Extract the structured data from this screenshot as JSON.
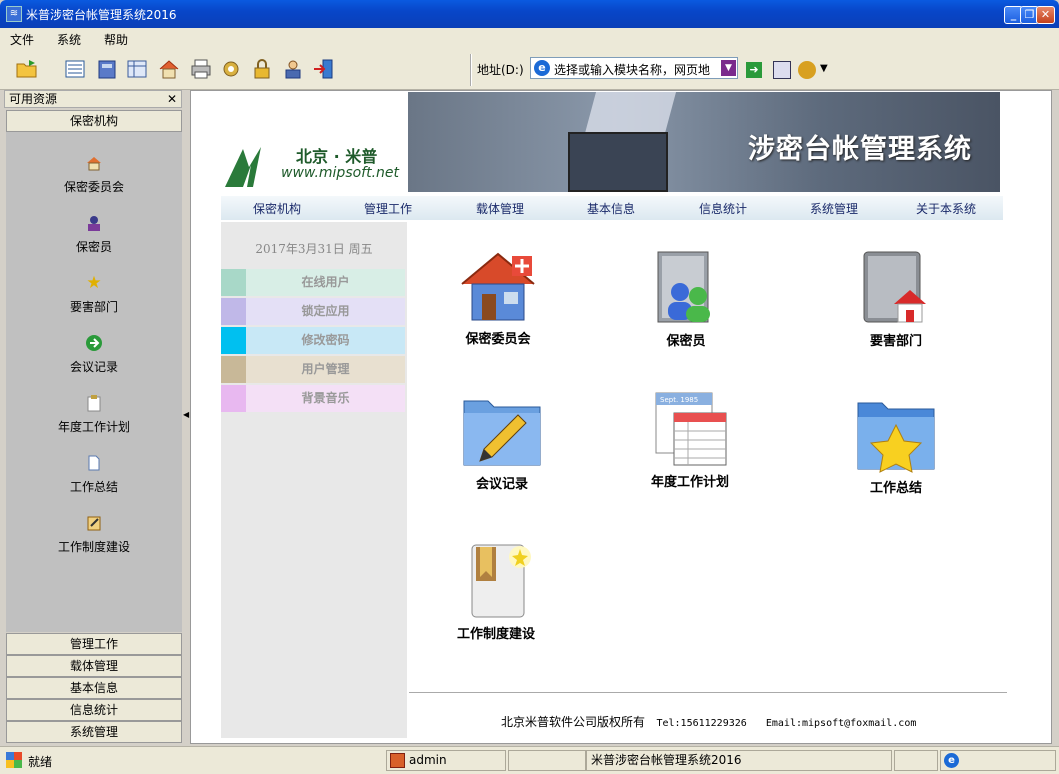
{
  "window": {
    "title": "米普涉密台帐管理系统2016",
    "min_icon": "minimize-icon",
    "max_icon": "restore-icon",
    "close_icon": "close-icon"
  },
  "menu": [
    "文件",
    "系统",
    "帮助"
  ],
  "toolbar": {
    "icons": [
      "open-icon",
      "list-icon",
      "book-icon",
      "table-icon",
      "home-icon",
      "print-icon",
      "settings-icon",
      "lock-icon",
      "user-lock-icon",
      "exit-icon"
    ]
  },
  "address": {
    "label": "地址(D:)",
    "value": "选择或输入模块名称，网页地",
    "go_icon": "go-icon"
  },
  "leftpanel": {
    "title": "可用资源",
    "close": "✕",
    "active_tab": "保密机构",
    "items": [
      "保密委员会",
      "保密员",
      "要害部门",
      "会议记录",
      "年度工作计划",
      "工作总结",
      "工作制度建设"
    ],
    "bottom_tabs": [
      "管理工作",
      "载体管理",
      "基本信息",
      "信息统计",
      "系统管理"
    ]
  },
  "banner": {
    "logo_cn": "北京 · 米普",
    "logo_en": "www.mipsoft.net",
    "title": "涉密台帐管理系统"
  },
  "nav": [
    "保密机构",
    "管理工作",
    "载体管理",
    "基本信息",
    "信息统计",
    "系统管理",
    "关于本系统"
  ],
  "date": "2017年3月31日 周五",
  "side_menu": [
    {
      "label": "在线用户",
      "color": "#a8d8c8",
      "bg": "#d8eee6"
    },
    {
      "label": "锁定应用",
      "color": "#c0b8e8",
      "bg": "#e4e0f6"
    },
    {
      "label": "修改密码",
      "color": "#00c0f0",
      "bg": "#c8e8f6"
    },
    {
      "label": "用户管理",
      "color": "#c8b898",
      "bg": "#e8e0d0"
    },
    {
      "label": "背景音乐",
      "color": "#e8b8f0",
      "bg": "#f4e0f6"
    }
  ],
  "modules": [
    "保密委员会",
    "保密员",
    "要害部门",
    "会议记录",
    "年度工作计划",
    "工作总结",
    "工作制度建设"
  ],
  "calendar_text": "Sept. 1985",
  "footer": {
    "copyright": "北京米普软件公司版权所有",
    "tel": "Tel:15611229326",
    "email": "Email:mipsoft@foxmail.com"
  },
  "status": {
    "ready": "就绪",
    "user": "admin",
    "app": "米普涉密台帐管理系统2016"
  }
}
